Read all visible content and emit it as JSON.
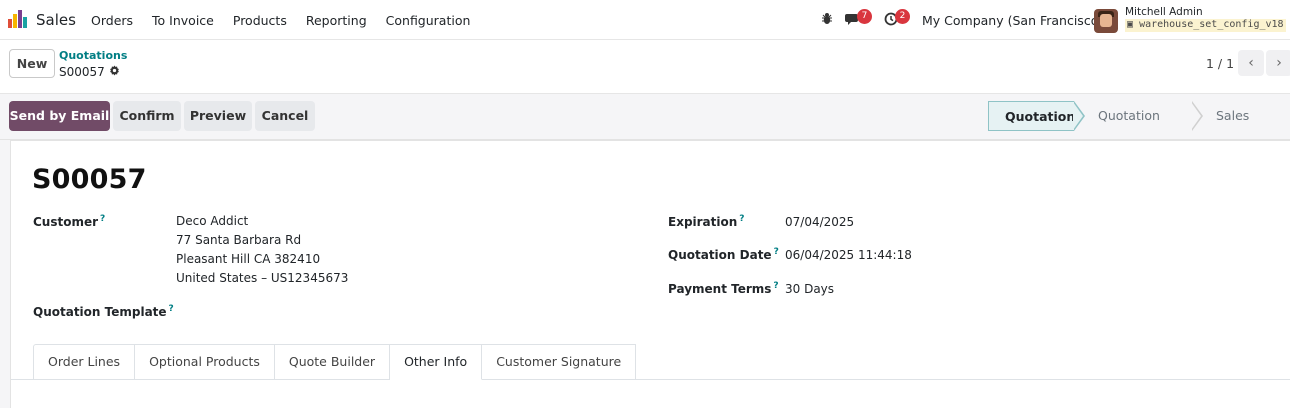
{
  "app": {
    "name": "Sales",
    "logo_colors": [
      "#e04e39",
      "#f7b500",
      "#7b3f8f",
      "#1aa3a3"
    ]
  },
  "nav": {
    "items": [
      "Orders",
      "To Invoice",
      "Products",
      "Reporting",
      "Configuration"
    ]
  },
  "systray": {
    "bug_icon": "bug-icon",
    "messages_icon": "chat-icon",
    "messages_count": "7",
    "activities_icon": "clock-icon",
    "activities_count": "2",
    "company": "My Company (San Francisco)",
    "user_name": "Mitchell Admin",
    "database": "warehouse_set_config_v18"
  },
  "control": {
    "new_label": "New",
    "breadcrumb_parent": "Quotations",
    "breadcrumb_current": "S00057",
    "pager": "1 / 1"
  },
  "actions": {
    "send_email": "Send by Email",
    "confirm": "Confirm",
    "preview": "Preview",
    "cancel": "Cancel",
    "primary_color": "#714b67"
  },
  "status": {
    "stages": [
      "Quotation",
      "Quotation Sent",
      "Sales Order"
    ],
    "active": "Quotation"
  },
  "form": {
    "title": "S00057",
    "customer_label": "Customer",
    "customer": {
      "name": "Deco Addict",
      "street": "77 Santa Barbara Rd",
      "city": "Pleasant Hill CA 382410",
      "country": "United States – US12345673"
    },
    "template_label": "Quotation Template",
    "expiration_label": "Expiration",
    "expiration": "07/04/2025",
    "date_label": "Quotation Date",
    "date": "06/04/2025 11:44:18",
    "terms_label": "Payment Terms",
    "terms": "30 Days",
    "help_mark": "?"
  },
  "tabs": {
    "items": [
      "Order Lines",
      "Optional Products",
      "Quote Builder",
      "Other Info",
      "Customer Signature"
    ],
    "active": "Other Info"
  }
}
